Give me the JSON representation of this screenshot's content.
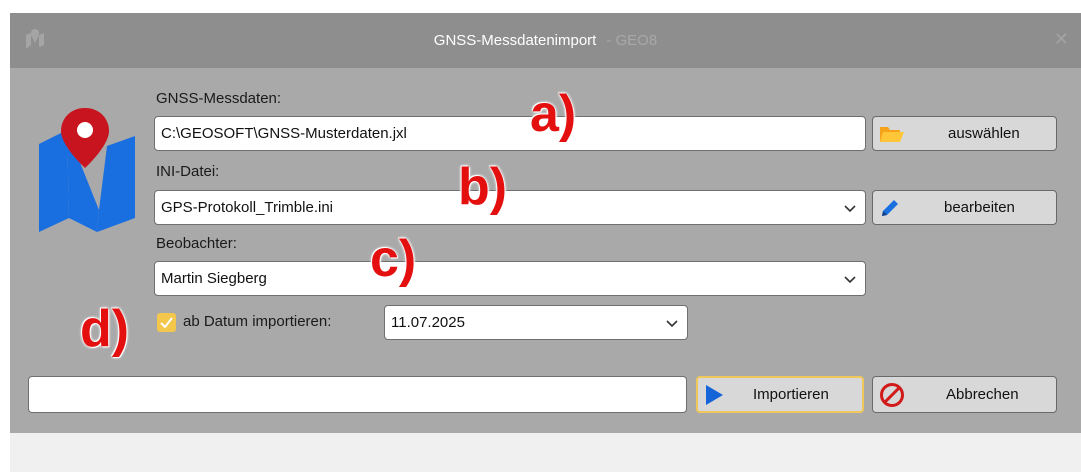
{
  "window": {
    "title": "GNSS-Messdatenimport",
    "title_suffix": "- GEO8",
    "close_glyph": "✕"
  },
  "fields": {
    "messdaten": {
      "label": "GNSS-Messdaten:",
      "value": "C:\\GEOSOFT\\GNSS-Musterdaten.jxl"
    },
    "ini": {
      "label": "INI-Datei:",
      "value": "GPS-Protokoll_Trimble.ini"
    },
    "beobachter": {
      "label": "Beobachter:",
      "value": "Martin Siegberg"
    },
    "datum": {
      "checkbox_label": "ab Datum importieren:",
      "value": "11.07.2025",
      "checked": true
    },
    "status": {
      "value": ""
    }
  },
  "buttons": {
    "auswaehlen": "auswählen",
    "bearbeiten": "bearbeiten",
    "importieren": "Importieren",
    "abbrechen": "Abbrechen"
  },
  "annotations": {
    "a": "a)",
    "b": "b)",
    "c": "c)",
    "d": "d)"
  },
  "colors": {
    "annotation": "#e41010",
    "logo_blue": "#1a6fe0",
    "pin_red": "#c8141e",
    "checkbox_yellow": "#f3c74c",
    "focus_border": "#f0c75a",
    "play_blue": "#1565d8",
    "stop_red": "#d11a1a"
  },
  "icons": {
    "logo": "map-pin-logo-icon",
    "folder": "folder-open-icon",
    "edit": "pencil-icon",
    "play": "play-icon",
    "cancel": "no-entry-icon",
    "chevron": "chevron-down-icon",
    "check": "check-icon"
  }
}
